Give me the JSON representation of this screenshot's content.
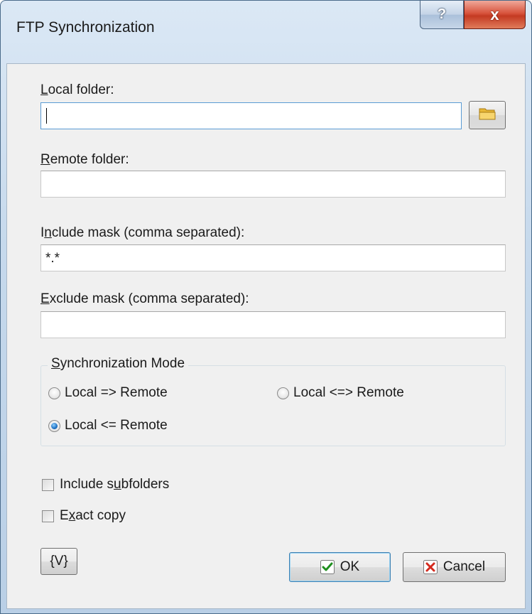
{
  "window": {
    "title": "FTP Synchronization",
    "help_glyph": "?",
    "close_glyph": "x"
  },
  "fields": {
    "local_folder": {
      "label_accel": "L",
      "label_rest": "ocal folder:",
      "value": ""
    },
    "remote_folder": {
      "label_accel": "R",
      "label_rest": "emote folder:",
      "value": ""
    },
    "include_mask": {
      "label_pre": "I",
      "label_accel": "n",
      "label_rest": "clude mask (comma separated):",
      "value": "*.*"
    },
    "exclude_mask": {
      "label_accel": "E",
      "label_rest": "xclude mask (comma separated):",
      "value": ""
    }
  },
  "sync_mode": {
    "legend_accel": "S",
    "legend_rest": "ynchronization Mode",
    "options": [
      {
        "label": "Local => Remote",
        "checked": false
      },
      {
        "label": "Local <=> Remote",
        "checked": false
      },
      {
        "label": "Local <= Remote",
        "checked": true
      }
    ]
  },
  "checkboxes": {
    "include_subfolders": {
      "pre": "Include s",
      "accel": "u",
      "rest": "bfolders",
      "checked": false
    },
    "exact_copy": {
      "pre": "E",
      "accel": "x",
      "rest": "act copy",
      "checked": false
    }
  },
  "buttons": {
    "variables": "{V}",
    "ok": "OK",
    "cancel": "Cancel"
  },
  "icons": {
    "browse": "folder-icon",
    "ok": "checkmark-icon",
    "cancel": "red-x-icon",
    "ok_color": "#1f8f1f",
    "cancel_color": "#d42a1e",
    "folder_color": "#f2c347"
  }
}
